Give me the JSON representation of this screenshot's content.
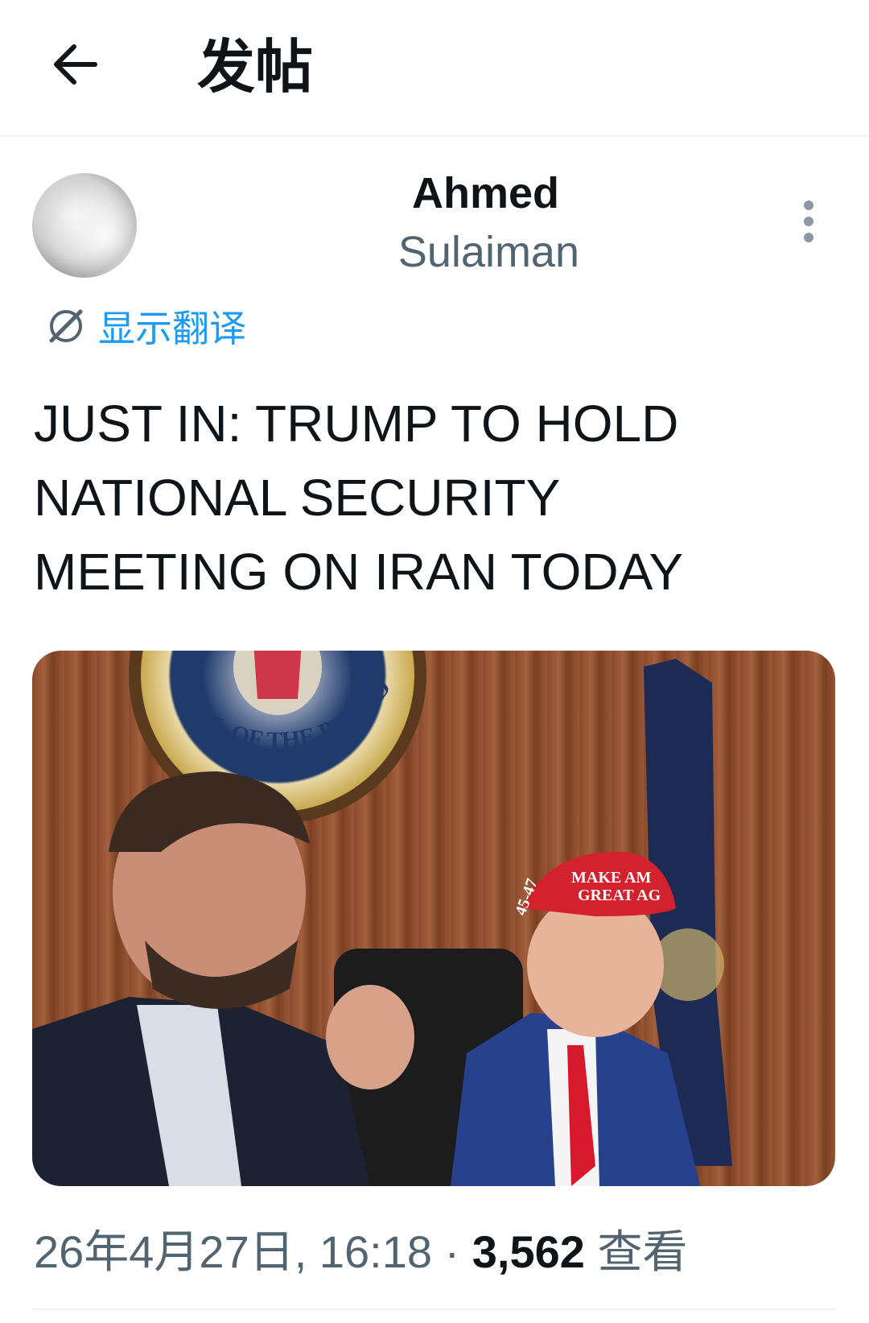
{
  "header": {
    "title": "发帖"
  },
  "author": {
    "name": "Ahmed",
    "handle": "Sulaiman"
  },
  "translate_label": "显示翻译",
  "tweet": {
    "text": "JUST IN: TRUMP TO HOLD\nNATIONAL SECURITY\nMEETING ON IRAN TODAY"
  },
  "photo": {
    "seal_text": "SEAL OF THE PRESIDENT OF THE UNITED STATES",
    "hat_line1": "MAKE AM",
    "hat_line2": "GREAT AG",
    "hat_side": "45-47"
  },
  "meta": {
    "timestamp": "26年4月27日, 16:18",
    "separator": "·",
    "views_count": "3,562",
    "views_label": "查看"
  },
  "colors": {
    "accent": "#1d9bf0",
    "text": "#0f1419",
    "secondary": "#536471",
    "divider": "#eff3f4"
  }
}
